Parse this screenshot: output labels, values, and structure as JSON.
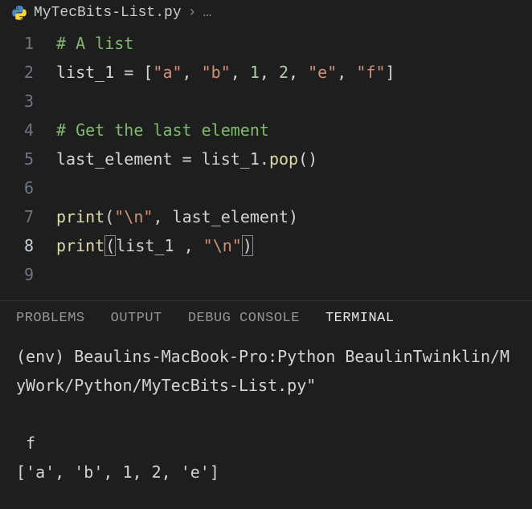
{
  "breadcrumb": {
    "filename": "MyTecBits-List.py",
    "ellipsis": "…"
  },
  "code_lines": [
    {
      "num": "1",
      "tokens": [
        {
          "t": "comment",
          "v": "# A list"
        }
      ]
    },
    {
      "num": "2",
      "tokens": [
        {
          "t": "ident",
          "v": "list_1 "
        },
        {
          "t": "punct",
          "v": "= ["
        },
        {
          "t": "string",
          "v": "\"a\""
        },
        {
          "t": "punct",
          "v": ", "
        },
        {
          "t": "string",
          "v": "\"b\""
        },
        {
          "t": "punct",
          "v": ", "
        },
        {
          "t": "number",
          "v": "1"
        },
        {
          "t": "punct",
          "v": ", "
        },
        {
          "t": "number",
          "v": "2"
        },
        {
          "t": "punct",
          "v": ", "
        },
        {
          "t": "string",
          "v": "\"e\""
        },
        {
          "t": "punct",
          "v": ", "
        },
        {
          "t": "string",
          "v": "\"f\""
        },
        {
          "t": "punct",
          "v": "]"
        }
      ]
    },
    {
      "num": "3",
      "tokens": []
    },
    {
      "num": "4",
      "tokens": [
        {
          "t": "comment",
          "v": "# Get the last element"
        }
      ]
    },
    {
      "num": "5",
      "tokens": [
        {
          "t": "ident",
          "v": "last_element "
        },
        {
          "t": "punct",
          "v": "= "
        },
        {
          "t": "ident",
          "v": "list_1"
        },
        {
          "t": "punct",
          "v": "."
        },
        {
          "t": "func",
          "v": "pop"
        },
        {
          "t": "punct",
          "v": "()"
        }
      ]
    },
    {
      "num": "6",
      "tokens": []
    },
    {
      "num": "7",
      "tokens": [
        {
          "t": "func",
          "v": "print"
        },
        {
          "t": "punct",
          "v": "("
        },
        {
          "t": "string",
          "v": "\"\\n\""
        },
        {
          "t": "punct",
          "v": ", "
        },
        {
          "t": "ident",
          "v": "last_element"
        },
        {
          "t": "punct",
          "v": ")"
        }
      ]
    },
    {
      "num": "8",
      "active": true,
      "tokens": [
        {
          "t": "func",
          "v": "print"
        },
        {
          "t": "punct bracket-hl",
          "v": "("
        },
        {
          "t": "ident",
          "v": "list_1 "
        },
        {
          "t": "punct",
          "v": ", "
        },
        {
          "t": "string",
          "v": "\"\\n\""
        },
        {
          "t": "punct bracket-hl",
          "v": ")"
        }
      ]
    },
    {
      "num": "9",
      "tokens": []
    }
  ],
  "panel_tabs": {
    "problems": "PROBLEMS",
    "output": "OUTPUT",
    "debug": "DEBUG CONSOLE",
    "terminal": "TERMINAL"
  },
  "terminal_output": "(env) Beaulins-MacBook-Pro:Python BeaulinTwinklin/MyWork/Python/MyTecBits-List.py\"\n\n f\n['a', 'b', 1, 2, 'e']"
}
